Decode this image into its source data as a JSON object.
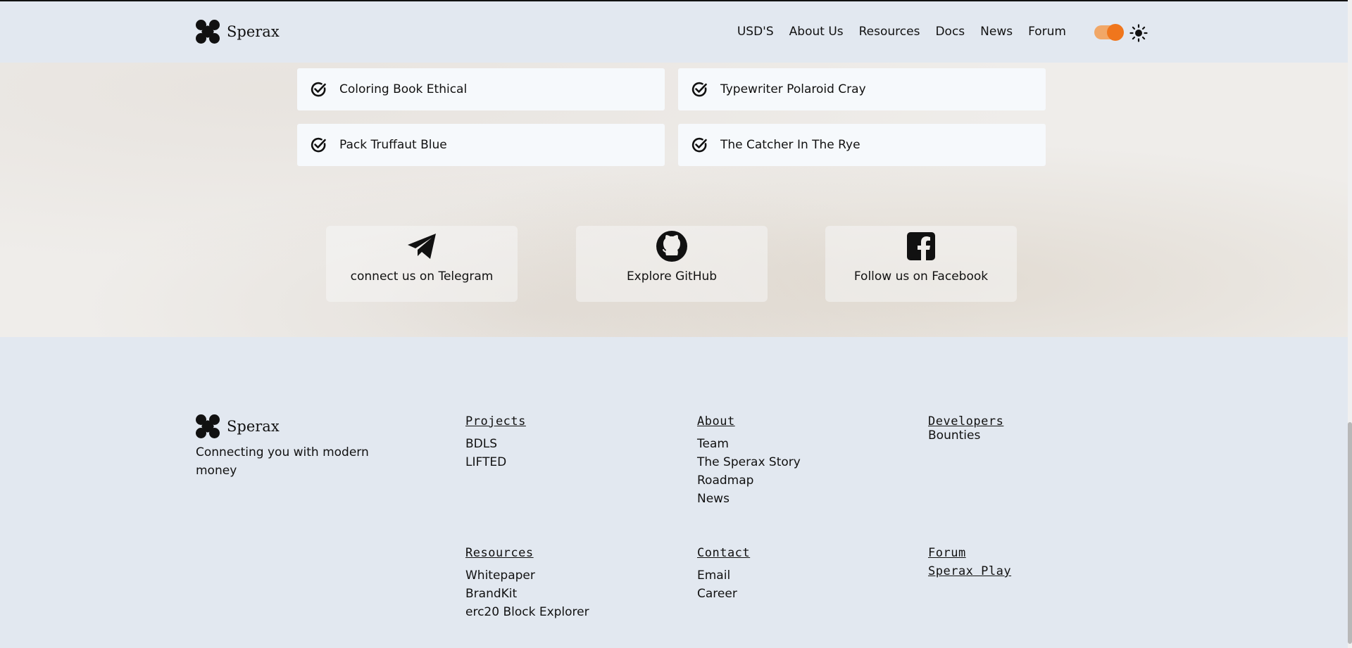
{
  "header": {
    "brand": "Sperax",
    "nav": [
      "USD'S",
      "About Us",
      "Resources",
      "Docs",
      "News",
      "Forum"
    ],
    "accent_color": "#f0761c",
    "theme_icon": "sun-icon"
  },
  "features": [
    {
      "label": "Coloring Book Ethical",
      "icon": "check-circle-icon"
    },
    {
      "label": "Typewriter Polaroid Cray",
      "icon": "check-circle-icon"
    },
    {
      "label": "Pack Truffaut Blue",
      "icon": "check-circle-icon"
    },
    {
      "label": "The Catcher In The Rye",
      "icon": "check-circle-icon"
    }
  ],
  "social": [
    {
      "label": "connect us on Telegram",
      "icon": "telegram-icon"
    },
    {
      "label": "Explore GitHub",
      "icon": "github-icon"
    },
    {
      "label": "Follow us on Facebook",
      "icon": "facebook-icon"
    }
  ],
  "footer": {
    "brand": "Sperax",
    "tagline": "Connecting you with modern money",
    "projects": {
      "title": "Projects",
      "links": [
        "BDLS",
        "LIFTED"
      ]
    },
    "about": {
      "title": "About",
      "links": [
        "Team",
        "The Sperax Story",
        "Roadmap",
        "News"
      ]
    },
    "developers": {
      "title": "Developers",
      "links": [
        "Bounties"
      ]
    },
    "resources": {
      "title": "Resources",
      "links": [
        "Whitepaper",
        "BrandKit",
        "erc20 Block Explorer"
      ]
    },
    "contact": {
      "title": "Contact",
      "links": [
        "Email",
        "Career"
      ]
    },
    "forum": {
      "title": "Forum"
    },
    "sperax_play": {
      "title": "Sperax Play"
    }
  }
}
